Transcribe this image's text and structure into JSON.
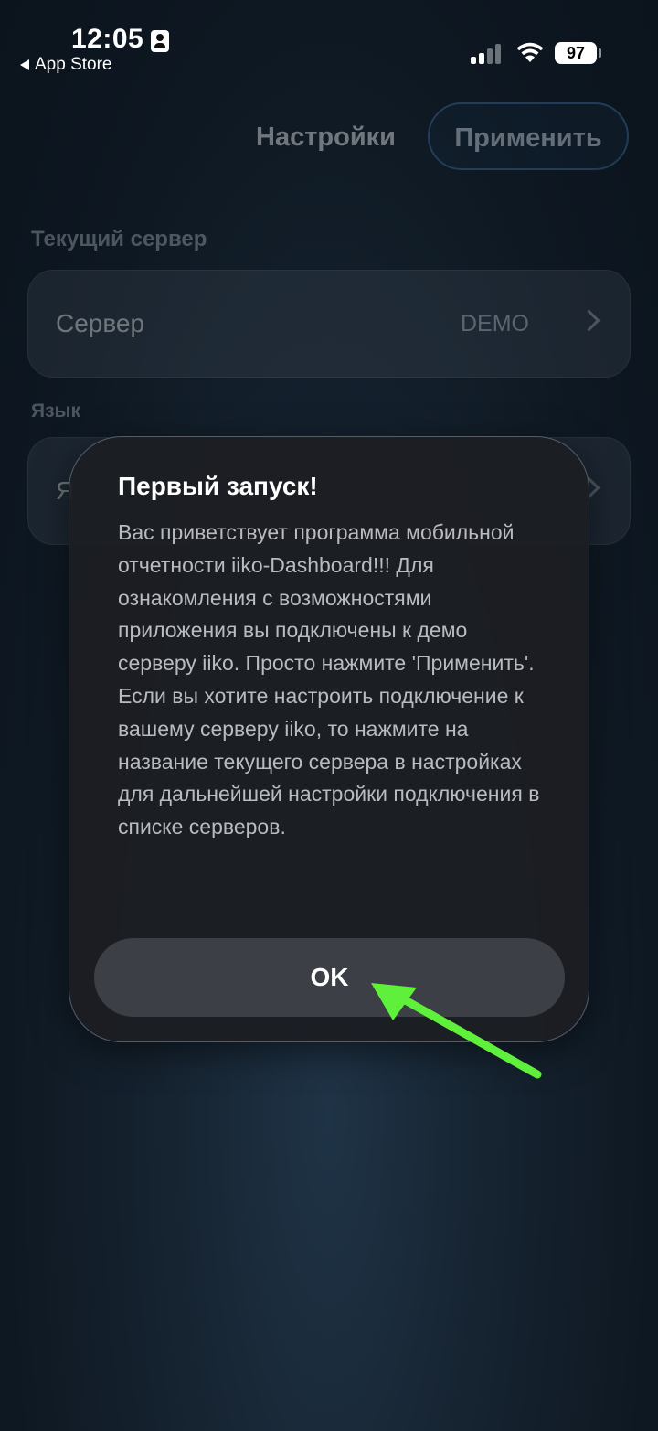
{
  "status_bar": {
    "time": "12:05",
    "back_app": "App Store",
    "battery": "97"
  },
  "nav": {
    "title": "Настройки",
    "apply_label": "Применить"
  },
  "settings": {
    "server_section_label": "Текущий сервер",
    "server_row": {
      "label": "Сервер",
      "value": "DEMO"
    },
    "language_section_label": "Язык",
    "language_row": {
      "label": "Я"
    }
  },
  "dialog": {
    "title": "Первый запуск!",
    "message": "Вас приветствует программа мобильной отчетности iiko-Dashboard!!! Для ознакомления с возможностями приложения вы подключены к демо серверу iiko. Просто нажмите 'Применить'. Если вы хотите настроить подключение к вашему серверу iiko, то нажмите на название текущего сервера в настройках для дальнейшей настройки подключения в списке серверов.",
    "ok_label": "OK"
  },
  "colors": {
    "annotation_arrow": "#5ef03a",
    "apply_border": "#3b6c99"
  }
}
